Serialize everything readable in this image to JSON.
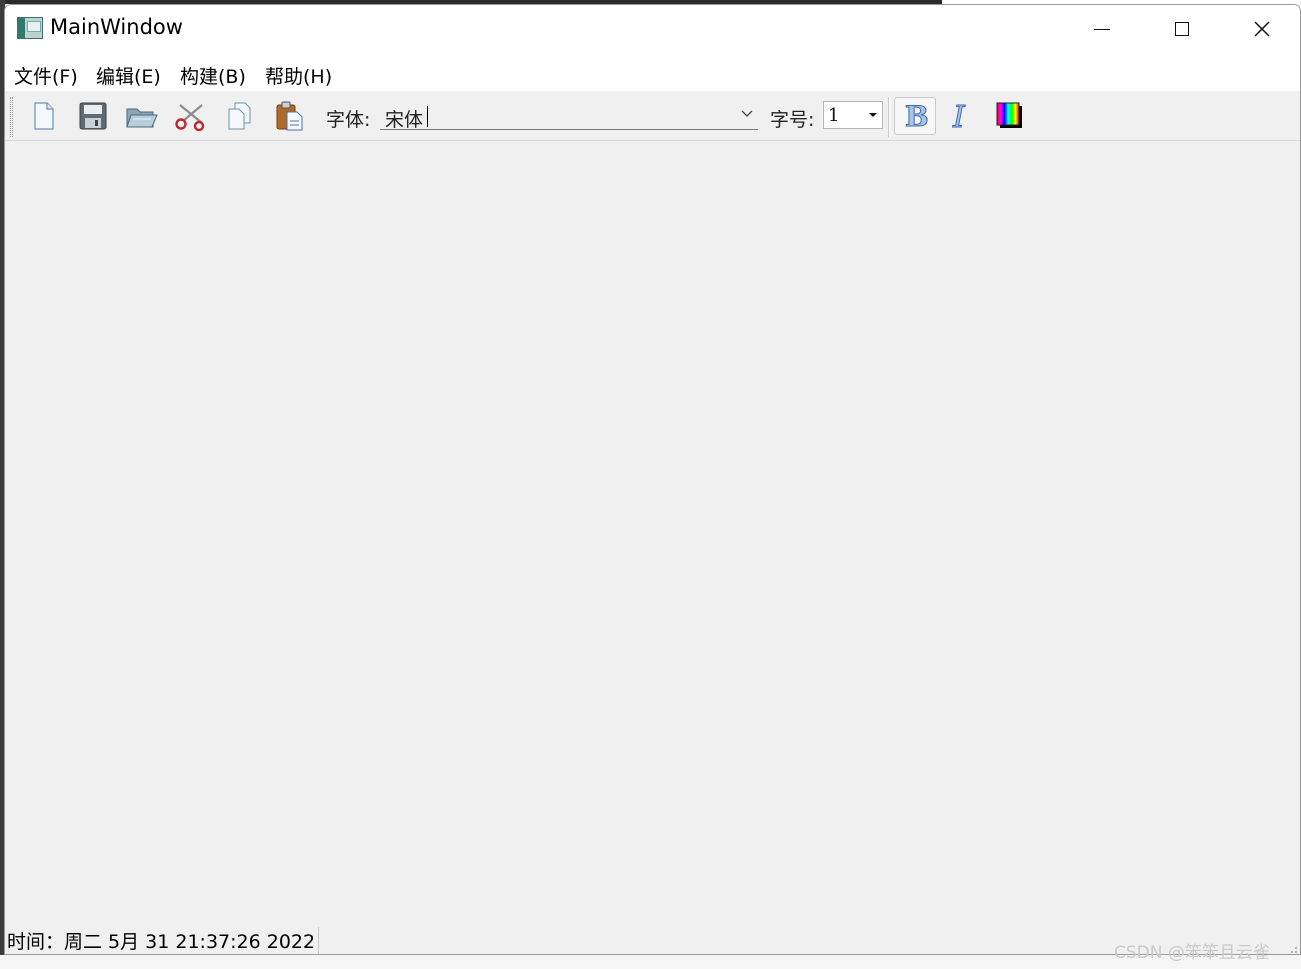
{
  "window": {
    "title": "MainWindow"
  },
  "menubar": {
    "items": [
      "文件(F)",
      "编辑(E)",
      "构建(B)",
      "帮助(H)"
    ]
  },
  "toolbar": {
    "actions": [
      {
        "name": "new",
        "icon": "new-file-icon"
      },
      {
        "name": "save",
        "icon": "floppy-disk-icon"
      },
      {
        "name": "open",
        "icon": "open-folder-icon"
      },
      {
        "name": "cut",
        "icon": "scissors-icon"
      },
      {
        "name": "copy",
        "icon": "copy-icon"
      },
      {
        "name": "paste",
        "icon": "paste-icon"
      }
    ],
    "font_label": "字体:",
    "font_value": "宋体",
    "size_label": "字号:",
    "size_value": "1",
    "bold_icon": "bold-icon",
    "italic_icon": "italic-icon",
    "color_icon": "color-palette-icon"
  },
  "statusbar": {
    "text": "时间：周二 5月 31 21:37:26 2022"
  },
  "watermark": "CSDN @笨笨且云雀"
}
